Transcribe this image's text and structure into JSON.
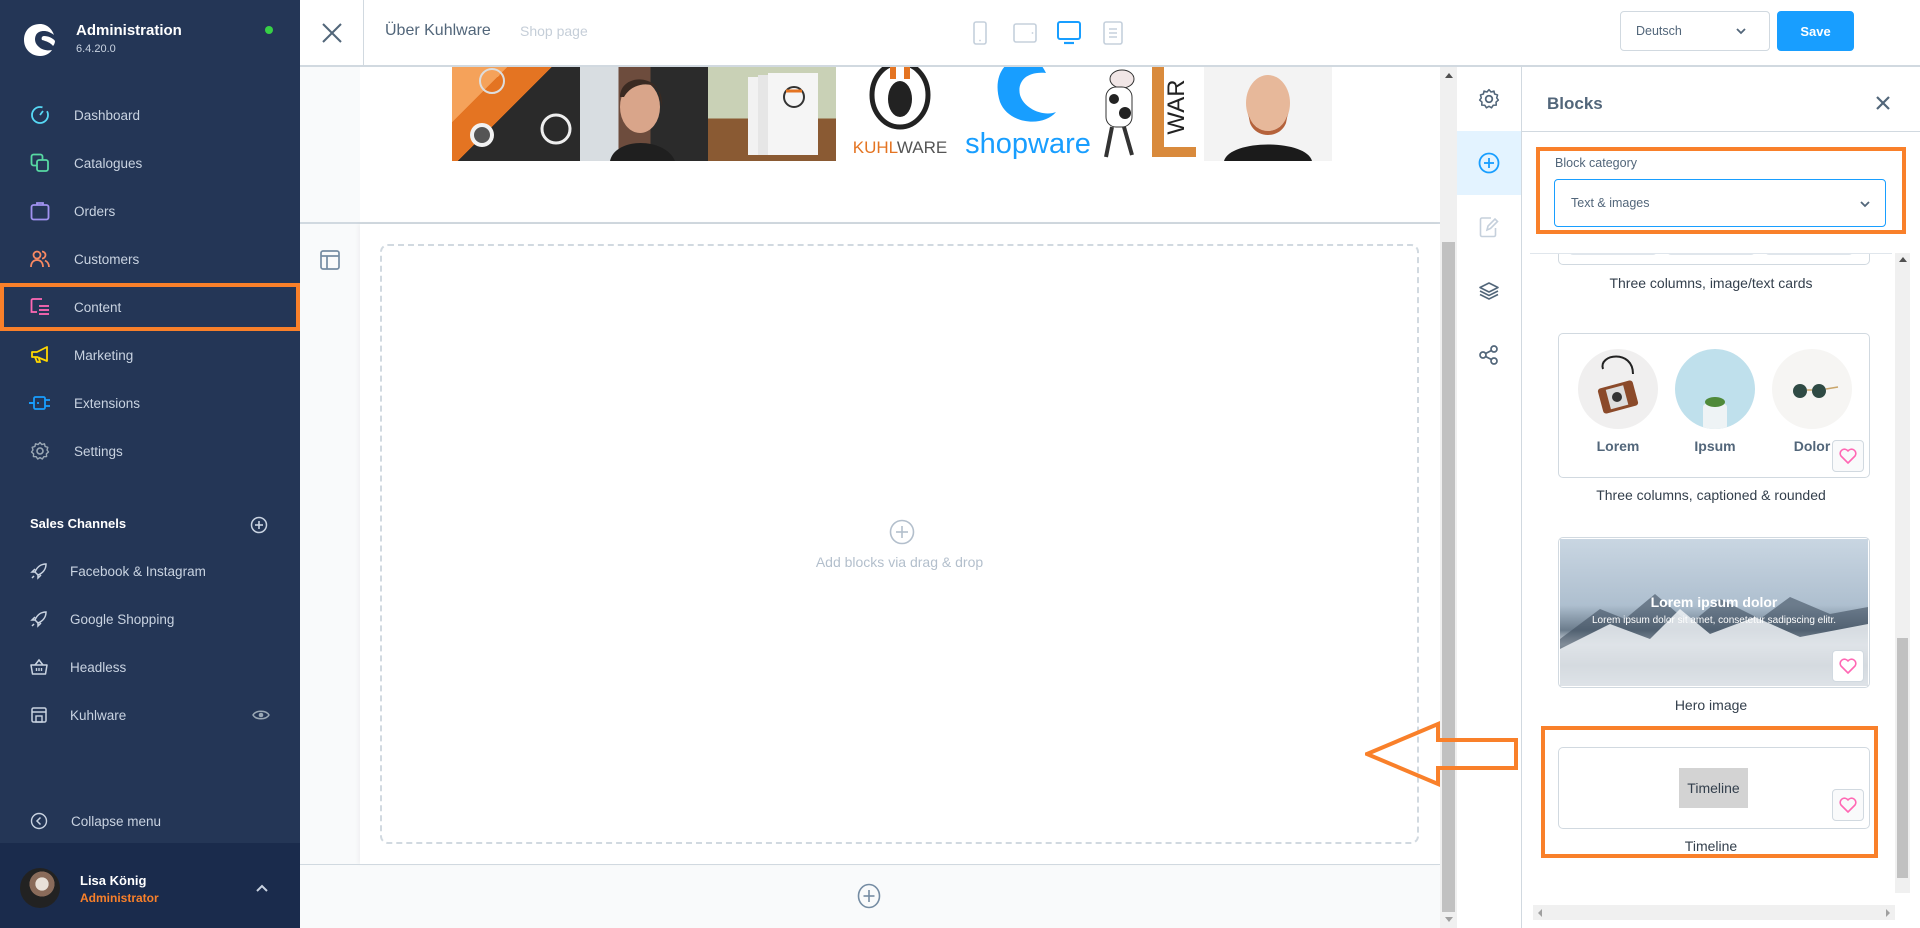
{
  "app": {
    "title": "Administration",
    "version": "6.4.20.0",
    "status_color": "#37d046"
  },
  "sidebar": {
    "items": [
      {
        "label": "Dashboard",
        "icon": "dashboard-icon",
        "color": "#57d9f5"
      },
      {
        "label": "Catalogues",
        "icon": "catalogues-icon",
        "color": "#57d9a3"
      },
      {
        "label": "Orders",
        "icon": "orders-icon",
        "color": "#a092f0"
      },
      {
        "label": "Customers",
        "icon": "customers-icon",
        "color": "#f88962"
      },
      {
        "label": "Content",
        "icon": "content-icon",
        "color": "#ff68b4",
        "highlighted": true
      },
      {
        "label": "Marketing",
        "icon": "marketing-icon",
        "color": "#ffd700"
      },
      {
        "label": "Extensions",
        "icon": "extensions-icon",
        "color": "#189eff"
      },
      {
        "label": "Settings",
        "icon": "settings-icon",
        "color": "#9aa8b5"
      }
    ],
    "sales_channels": {
      "heading": "Sales Channels",
      "items": [
        {
          "label": "Facebook & Instagram",
          "icon": "rocket-icon"
        },
        {
          "label": "Google Shopping",
          "icon": "rocket-icon"
        },
        {
          "label": "Headless",
          "icon": "basket-icon"
        },
        {
          "label": "Kuhlware",
          "icon": "storefront-icon",
          "visible_eye": true
        }
      ]
    },
    "collapse_label": "Collapse menu",
    "user": {
      "name": "Lisa König",
      "role": "Administrator"
    }
  },
  "topbar": {
    "page_title": "Über Kuhlware",
    "page_type": "Shop page",
    "devices": [
      "mobile",
      "tablet",
      "desktop",
      "form"
    ],
    "active_device": "desktop",
    "language": "Deutsch",
    "save_label": "Save"
  },
  "canvas": {
    "gallery_images": [
      "Merchandise caps",
      "Woman portrait",
      "Brochures",
      "Kuhlware logo",
      "Shopware logo",
      "Cow mascot",
      "Kuhlware banner",
      "Man portrait"
    ],
    "kuhlware_logo_text": {
      "orange": "KUHL",
      "gray": "WARE"
    },
    "shopware_logo_text": "shopware",
    "dropzone_text": "Add blocks via drag & drop"
  },
  "panel": {
    "title": "Blocks",
    "category_label": "Block category",
    "category_value": "Text & images",
    "blocks": [
      {
        "caption": "Three columns, image/text cards"
      },
      {
        "caption": "Three columns, captioned & rounded",
        "columns": [
          "Lorem",
          "Ipsum",
          "Dolor"
        ]
      },
      {
        "caption": "Hero image",
        "headline": "Lorem ipsum dolor",
        "subline": "Lorem ipsum dolor sit amet, consetetur sadipscing elitr."
      },
      {
        "caption": "Timeline",
        "preview_label": "Timeline",
        "highlighted": true
      }
    ]
  },
  "annotation": {
    "color": "#f9802a"
  }
}
